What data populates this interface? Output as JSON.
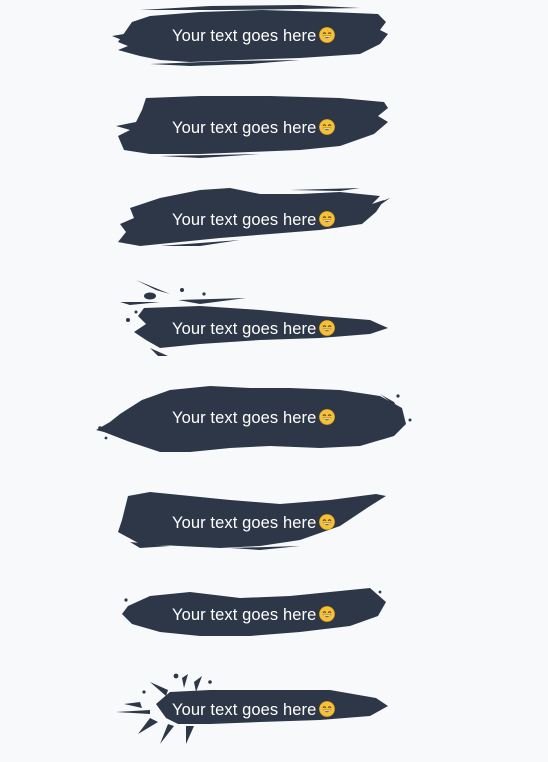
{
  "colors": {
    "background": "#f8f9fb",
    "brush": "#2d3748",
    "text": "#ffffff",
    "emoji": "#f5c136"
  },
  "items": [
    {
      "label": "Your text goes here",
      "icon": "grinning-face-icon"
    },
    {
      "label": "Your text goes here",
      "icon": "grinning-face-icon"
    },
    {
      "label": "Your text goes here",
      "icon": "grinning-face-icon"
    },
    {
      "label": "Your text goes here",
      "icon": "grinning-face-icon"
    },
    {
      "label": "Your text goes here",
      "icon": "grinning-face-icon"
    },
    {
      "label": "Your text goes here",
      "icon": "grinning-face-icon"
    },
    {
      "label": "Your text goes here",
      "icon": "grinning-face-icon"
    },
    {
      "label": "Your text goes here",
      "icon": "grinning-face-icon"
    }
  ]
}
